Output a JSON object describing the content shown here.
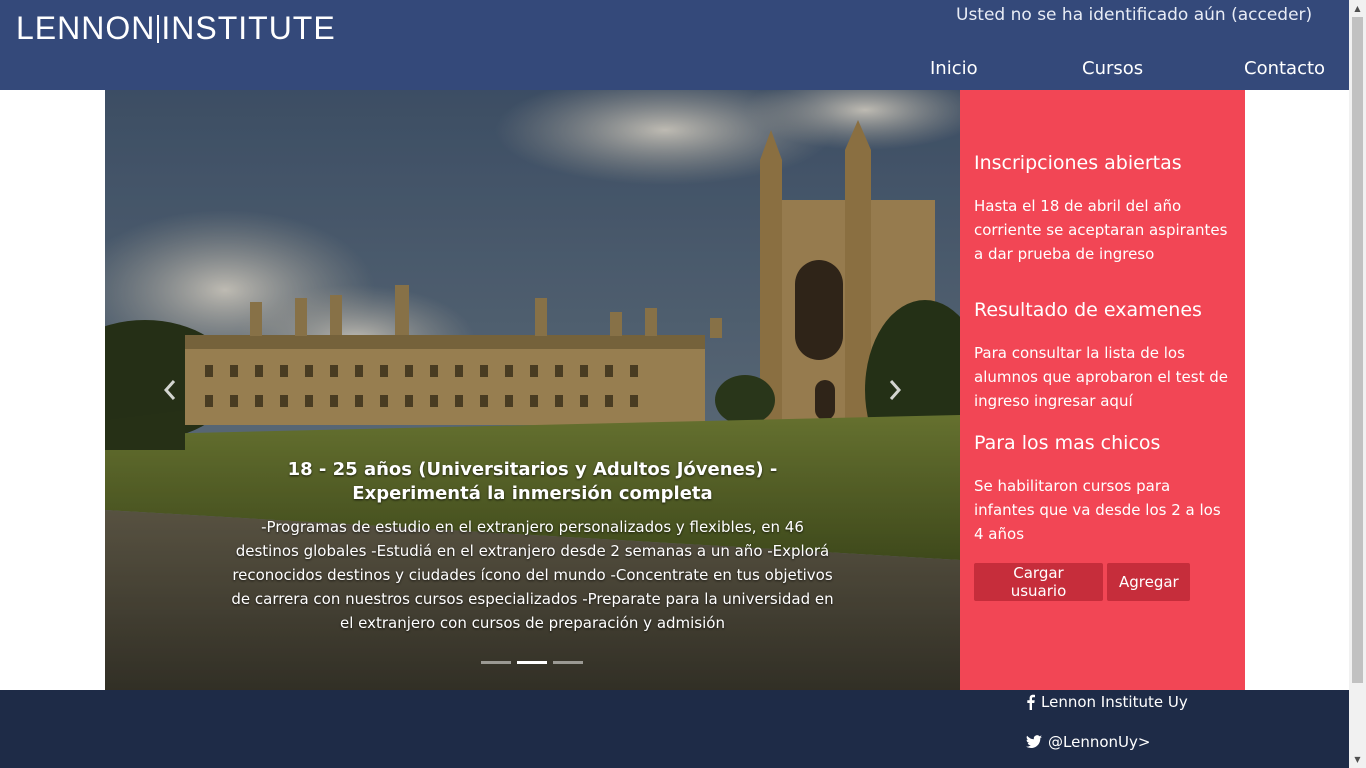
{
  "header": {
    "brand_left": "LENNON",
    "brand_right": "INSTITUTE",
    "login_status": "Usted no se ha identificado aún (acceder)",
    "nav": [
      "Inicio",
      "Cursos",
      "Contacto"
    ]
  },
  "carousel": {
    "caption_title": "18 - 25 años (Universitarios y Adultos Jóvenes) - Experimentá la inmersión completa",
    "caption_text": "-Programas de estudio en el extranjero personalizados y flexibles, en 46 destinos globales -Estudiá en el extranjero desde 2 semanas a un año -Explorá reconocidos destinos y ciudades ícono del mundo -Concentrate en tus objetivos de carrera con nuestros cursos especializados -Preparate para la universidad en el extranjero con cursos de preparación y admisión",
    "prev_icon": "chevron-left-icon",
    "next_icon": "chevron-right-icon",
    "indicator_count": 3,
    "active_indicator": 2
  },
  "sidebar": {
    "sections": [
      {
        "title": "Inscripciones abiertas",
        "text": "Hasta el 18 de abril del año corriente se aceptaran aspirantes a dar prueba de ingreso"
      },
      {
        "title": "Resultado de examenes",
        "text": "Para consultar la lista de los alumnos que aprobaron el test de ingreso ingresar aquí"
      },
      {
        "title": "Para los mas chicos",
        "text": "Se habilitaron cursos para infantes que va desde los 2 a los 4 años"
      }
    ],
    "buttons": {
      "load_user": "Cargar usuario",
      "add": "Agregar"
    }
  },
  "footer": {
    "facebook": "Lennon Institute Uy",
    "twitter": "@LennonUy>"
  },
  "colors": {
    "header_bg": "#34497a",
    "sidebar_bg": "#f24655",
    "button_bg": "#c62d3b",
    "footer_bg": "#1e2b47"
  }
}
